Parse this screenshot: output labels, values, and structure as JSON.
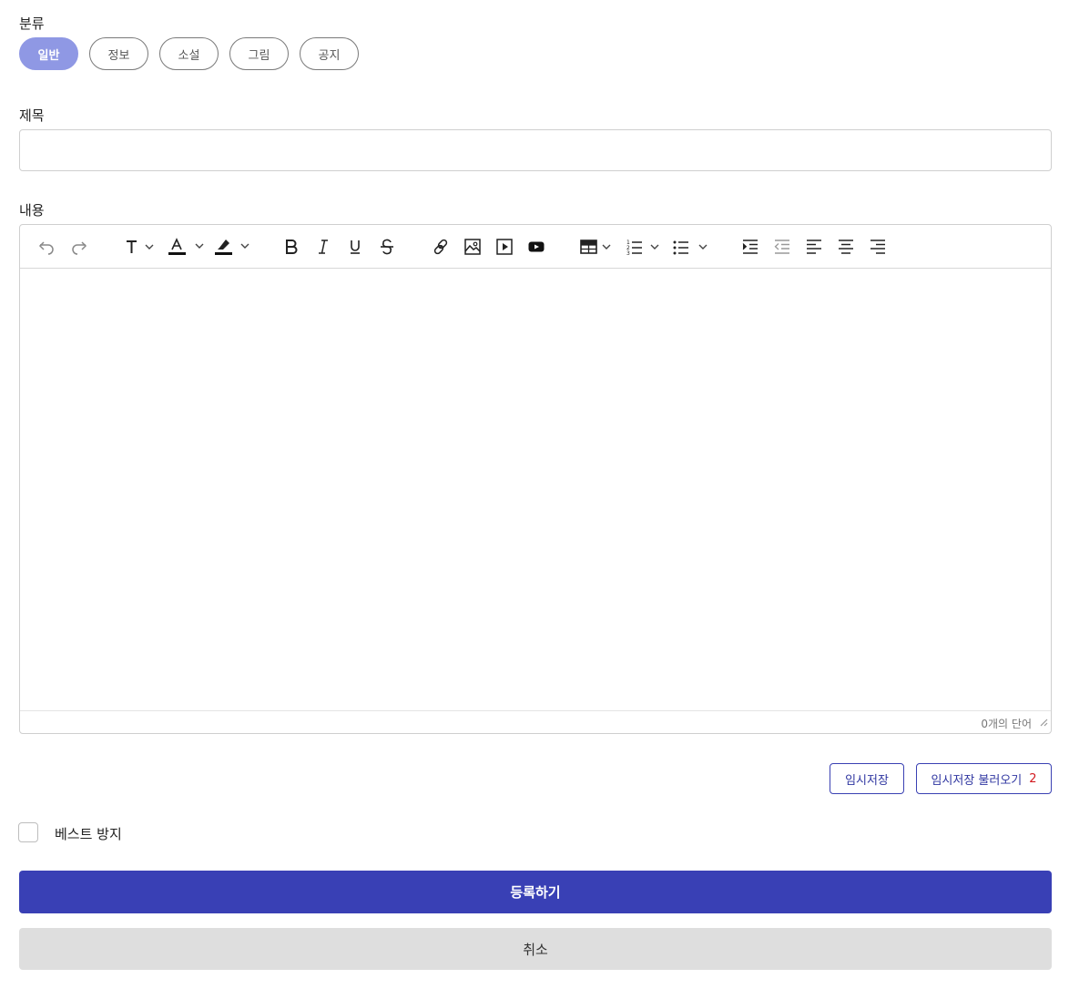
{
  "category": {
    "label": "분류",
    "options": [
      "일반",
      "정보",
      "소설",
      "그림",
      "공지"
    ],
    "selected": "일반"
  },
  "title_field": {
    "label": "제목",
    "value": "",
    "placeholder": ""
  },
  "content": {
    "label": "내용",
    "toolbar": [
      "undo-icon",
      "redo-icon",
      "font-size-icon",
      "font-color-icon",
      "highlight-icon",
      "bold-icon",
      "italic-icon",
      "underline-icon",
      "strikethrough-icon",
      "link-icon",
      "image-icon",
      "media-icon",
      "youtube-icon",
      "table-icon",
      "numbered-list-icon",
      "bulleted-list-icon",
      "indent-icon",
      "outdent-icon",
      "align-left-icon",
      "align-center-icon",
      "align-right-icon"
    ],
    "word_count": "0개의 단어"
  },
  "draft": {
    "save_label": "임시저장",
    "load_label": "임시저장 불러오기",
    "load_count": "2"
  },
  "best_prevent": {
    "label": "베스트 방지",
    "checked": false
  },
  "actions": {
    "submit_label": "등록하기",
    "cancel_label": "취소"
  },
  "colors": {
    "accent": "#3940b5",
    "chip_active": "#8f98e4",
    "count_red": "#d2191f"
  }
}
